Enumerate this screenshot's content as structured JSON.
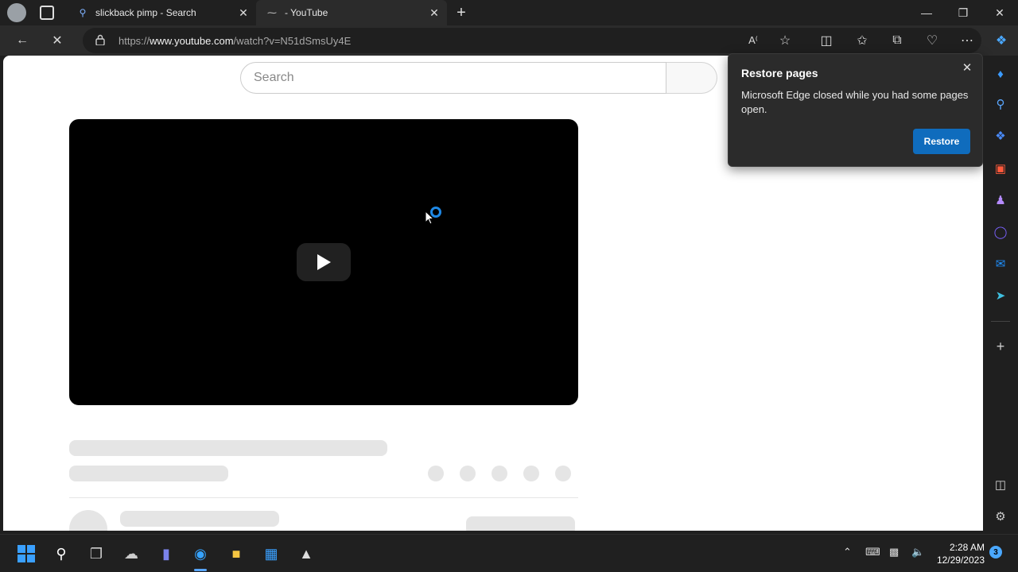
{
  "tabs": [
    {
      "title": "slickback pimp - Search",
      "icon": "search-icon"
    },
    {
      "title": "- YouTube",
      "icon": "youtube-loading-icon"
    }
  ],
  "address_bar": {
    "url_prefix": "https://",
    "url_host": "www.youtube.com",
    "url_path": "/watch?v=N51dSmsUy4E"
  },
  "page": {
    "search_placeholder": "Search"
  },
  "popup": {
    "title": "Restore pages",
    "message": "Microsoft Edge closed while you had some pages open.",
    "restore_label": "Restore"
  },
  "taskbar": {
    "time": "2:28 AM",
    "date": "12/29/2023",
    "notification_count": "3"
  },
  "colors": {
    "accent": "#0f6cbd",
    "chrome": "#2b2b2b",
    "page_bg": "#ffffff"
  }
}
